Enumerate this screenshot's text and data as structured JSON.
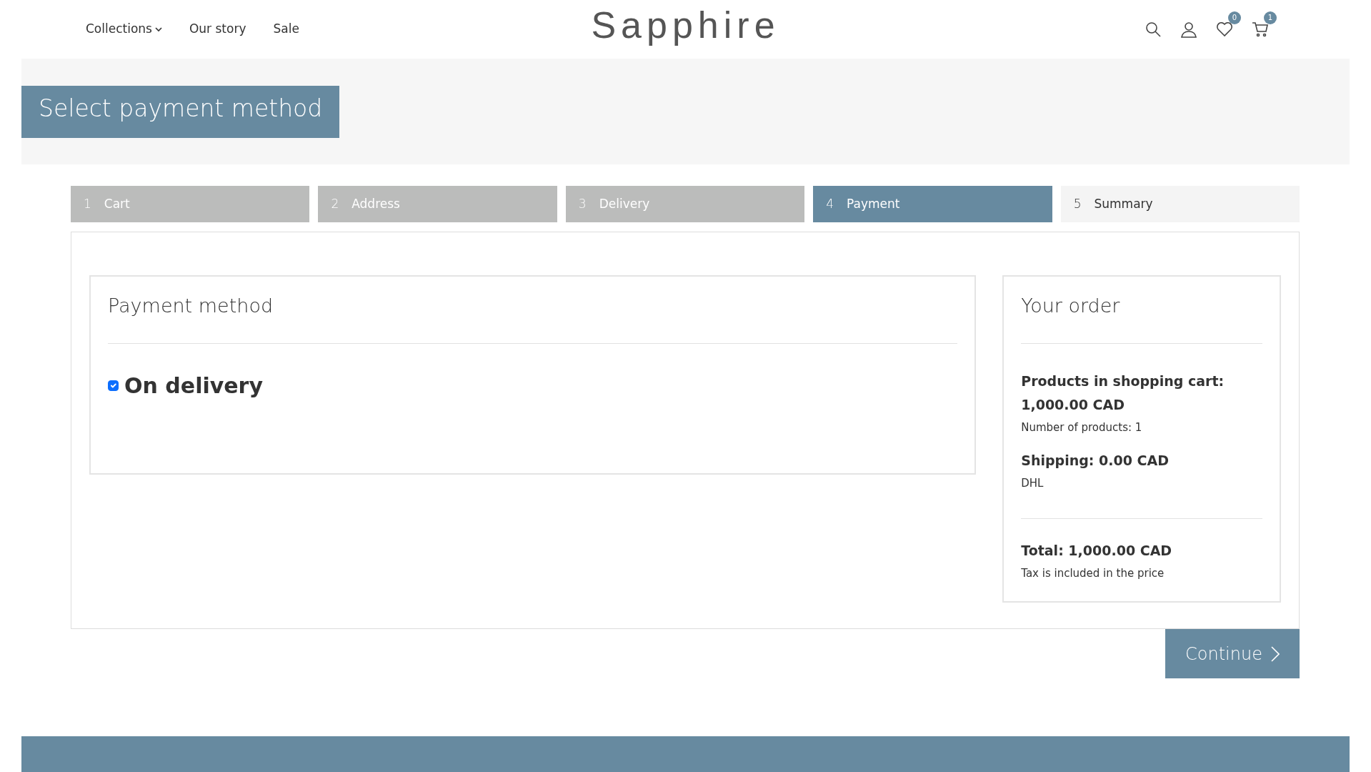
{
  "header": {
    "nav": [
      {
        "label": "Collections",
        "dropdown": true
      },
      {
        "label": "Our story",
        "dropdown": false
      },
      {
        "label": "Sale",
        "dropdown": false
      }
    ],
    "logo": "Sapphire",
    "wishlist_count": "0",
    "cart_count": "1"
  },
  "page_title": "Select payment method",
  "steps": [
    {
      "number": "1",
      "label": "Cart",
      "completed": true,
      "selected": false
    },
    {
      "number": "2",
      "label": "Address",
      "completed": true,
      "selected": false
    },
    {
      "number": "3",
      "label": "Delivery",
      "completed": true,
      "selected": false
    },
    {
      "number": "4",
      "label": "Payment",
      "completed": false,
      "selected": true
    },
    {
      "number": "5",
      "label": "Summary",
      "completed": false,
      "selected": false
    }
  ],
  "payment": {
    "title": "Payment method",
    "options": [
      {
        "label": "On delivery",
        "checked": true
      }
    ]
  },
  "order": {
    "title": "Your order",
    "products_label": "Products in shopping cart:",
    "products_total": "1,000.00 CAD",
    "product_count": "Number of products: 1",
    "shipping": "Shipping: 0.00 CAD",
    "carrier": "DHL",
    "total": "Total: 1,000.00 CAD",
    "tax_note": "Tax is included in the price"
  },
  "continue_button": "Continue"
}
